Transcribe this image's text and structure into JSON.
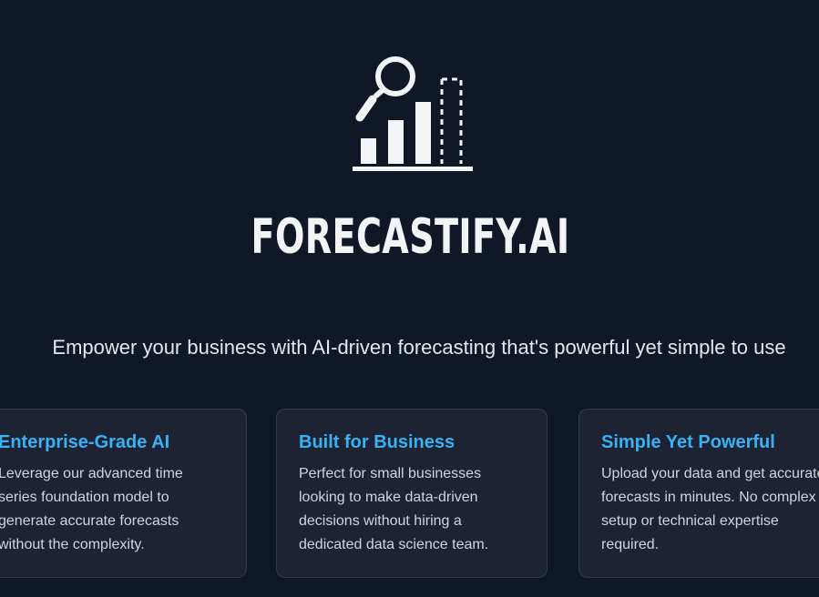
{
  "hero": {
    "logo_icon": "bar-chart-magnifier-icon",
    "brand_name": "FORECASTIFY.AI",
    "tagline": "Empower your business with AI-driven forecasting that's powerful yet simple to use"
  },
  "features": [
    {
      "title": "Enterprise-Grade AI",
      "description": "Leverage our advanced time series foundation model to generate accurate forecasts without the complexity."
    },
    {
      "title": "Built for Business",
      "description": "Perfect for small businesses looking to make data-driven decisions without hiring a dedicated data science team."
    },
    {
      "title": "Simple Yet Powerful",
      "description": "Upload your data and get accurate forecasts in minutes. No complex setup or technical expertise required."
    }
  ],
  "colors": {
    "background": "#101828",
    "card_background": "#1d2333",
    "accent": "#38b2f5",
    "text": "#e5e7eb"
  }
}
